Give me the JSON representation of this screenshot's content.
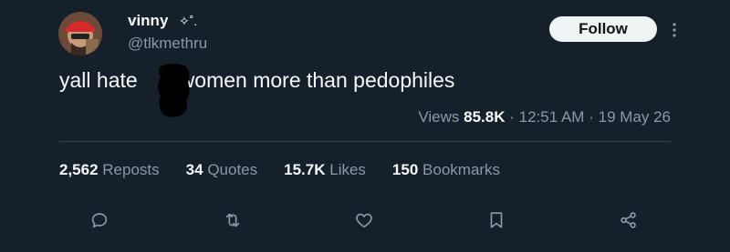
{
  "author": {
    "display_name": "vinny",
    "display_suffix": "✧˚.",
    "handle": "@tlkmethru"
  },
  "follow_button": {
    "label": "Follow"
  },
  "tweet": {
    "text_before": "yall hate",
    "text_after": "women more than pedophiles"
  },
  "meta": {
    "views_label": "Views",
    "views_count": "85.8K",
    "time": "12:51 AM",
    "date": "19 May 26",
    "separator": "·"
  },
  "stats": [
    {
      "count": "2,562",
      "label": "Reposts"
    },
    {
      "count": "34",
      "label": "Quotes"
    },
    {
      "count": "15.7K",
      "label": "Likes"
    },
    {
      "count": "150",
      "label": "Bookmarks"
    }
  ],
  "icons": {
    "reply": "reply-icon",
    "repost": "repost-icon",
    "like": "heart-icon",
    "bookmark": "bookmark-icon",
    "share": "share-icon",
    "more": "more-icon"
  },
  "colors": {
    "background": "#15202b",
    "text_primary": "#f7f9f9",
    "text_secondary": "#8b98a5",
    "divider": "#38444d",
    "button_bg": "#eff3f4"
  }
}
